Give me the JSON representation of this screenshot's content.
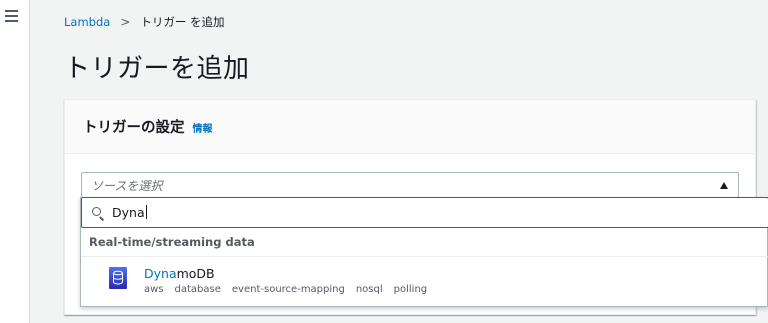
{
  "breadcrumb": {
    "root": "Lambda",
    "separator": ">",
    "current": "トリガー を追加"
  },
  "page": {
    "title": "トリガーを追加"
  },
  "panel": {
    "title": "トリガーの設定",
    "info_link": "情報"
  },
  "source_select": {
    "placeholder": "ソースを選択",
    "search_value": "Dyna",
    "group_label": "Real-time/streaming data",
    "option": {
      "title_match": "Dyna",
      "title_rest": "moDB",
      "icon": "dynamodb-icon",
      "tags": [
        "aws",
        "database",
        "event-source-mapping",
        "nosql",
        "polling"
      ]
    }
  },
  "colors": {
    "link": "#0073bb",
    "background": "#f2f3f3",
    "focus_border": "#0073bb",
    "dynamodb_icon": "#3b48cc"
  }
}
